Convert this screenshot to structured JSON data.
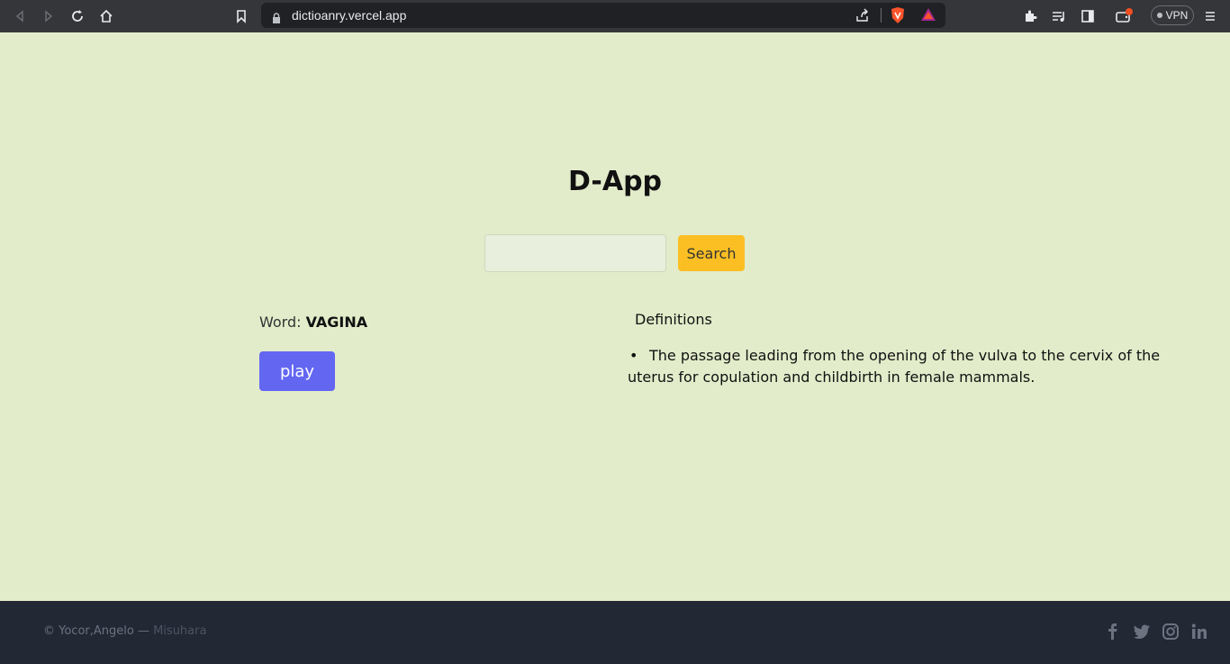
{
  "browser": {
    "url": "dictioanry.vercel.app",
    "vpn_label": "VPN",
    "icons": [
      "back-icon",
      "forward-icon",
      "reload-icon",
      "home-icon",
      "bookmark-icon",
      "lock-icon",
      "share-icon",
      "brave-shield-icon",
      "brave-rewards-icon",
      "extensions-icon",
      "media-icon",
      "sidebar-icon",
      "wallet-icon",
      "menu-icon"
    ]
  },
  "app": {
    "title": "D-App",
    "search": {
      "value": "",
      "placeholder": "",
      "button_label": "Search"
    },
    "word": {
      "label": "Word: ",
      "value": "VAGINA"
    },
    "play_label": "play",
    "definitions": {
      "title": "Definitions",
      "items": [
        "The passage leading from the opening of the vulva to the cervix of the uterus for copulation and childbirth in female mammals."
      ]
    }
  },
  "footer": {
    "copyright": "© Yocor,Angelo — ",
    "handle": "Misuhara",
    "social": [
      "facebook-icon",
      "twitter-icon",
      "instagram-icon",
      "linkedin-icon"
    ]
  },
  "colors": {
    "page_bg": "#e2ecca",
    "search_button": "#fbbf24",
    "play_button": "#6366f1",
    "footer_bg": "#222834"
  }
}
